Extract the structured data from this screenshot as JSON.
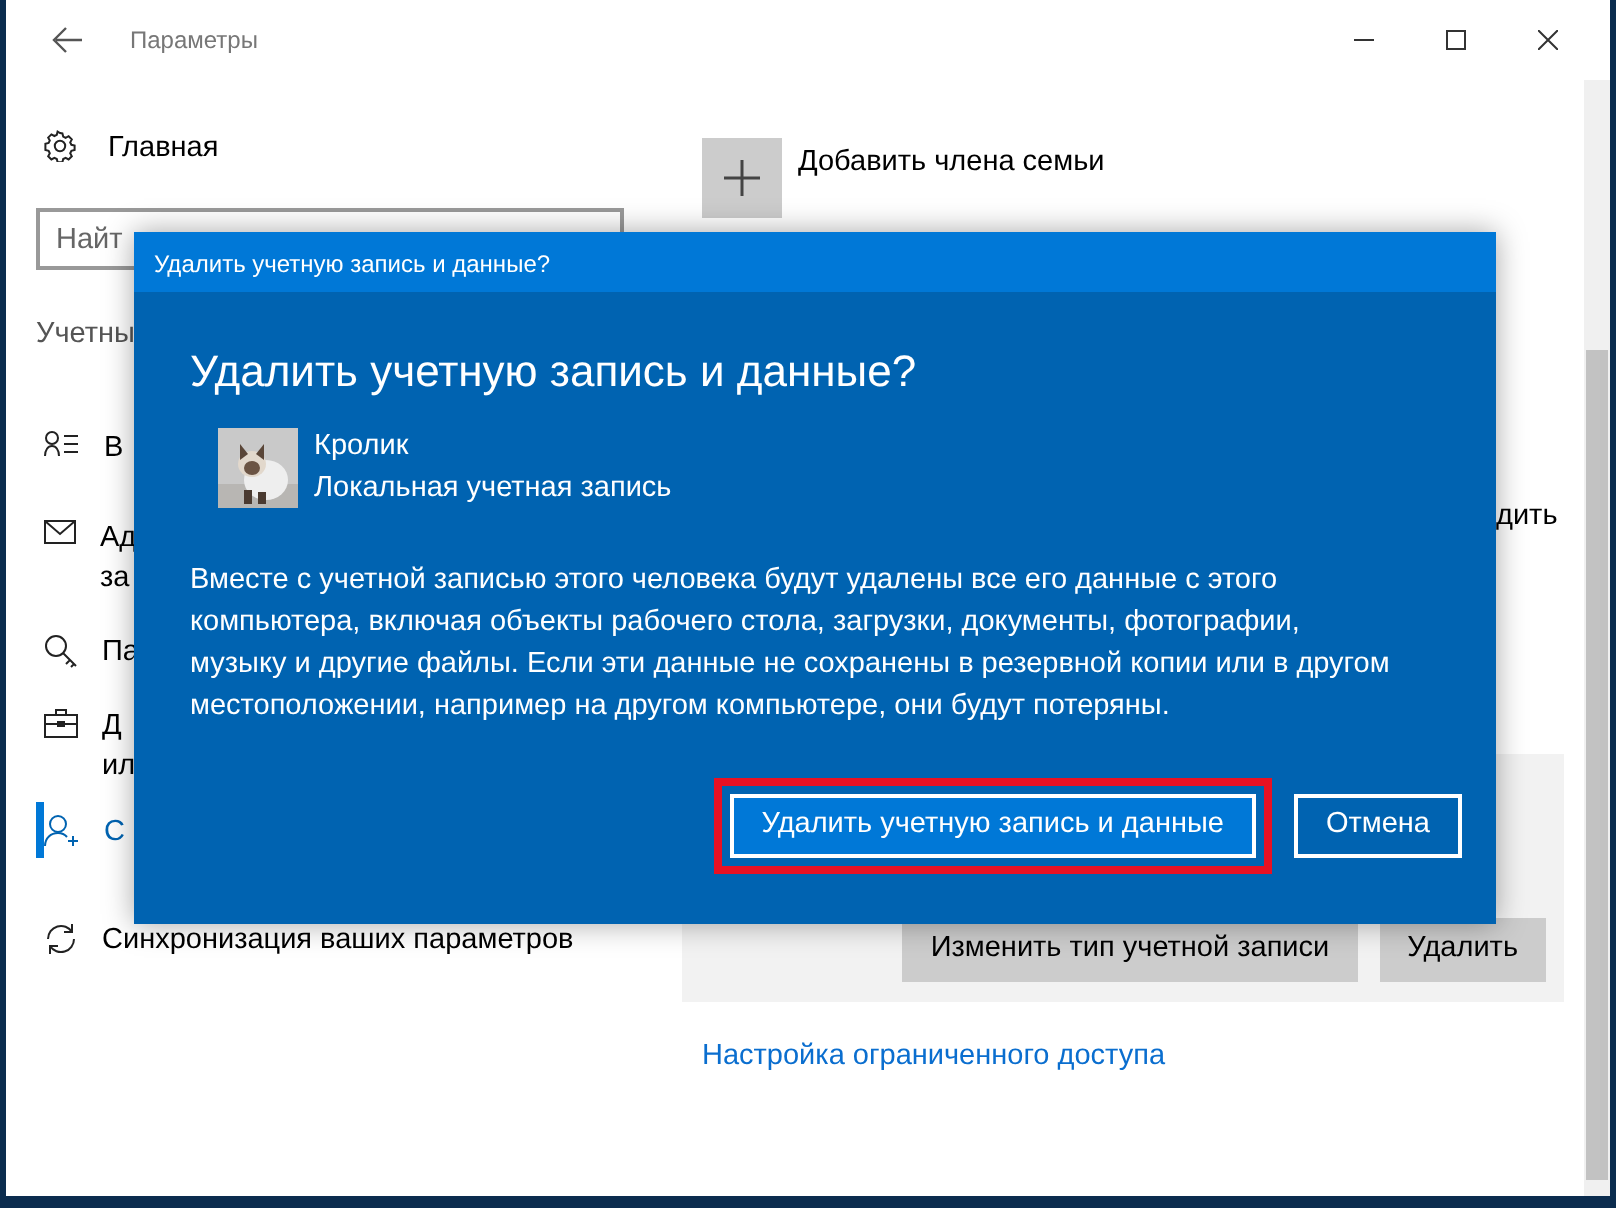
{
  "window": {
    "title": "Параметры"
  },
  "sidebar": {
    "home": "Главная",
    "search": {
      "placeholder": "Найт"
    },
    "section": "Учетны",
    "items": [
      {
        "lines": [
          "В"
        ],
        "selected": false
      },
      {
        "lines": [
          "Ад",
          "за"
        ],
        "selected": false
      },
      {
        "lines": [
          "Па"
        ],
        "selected": false
      },
      {
        "lines": [
          "Д",
          "ил"
        ],
        "selected": false
      },
      {
        "lines": [
          "С"
        ],
        "selected": true
      },
      {
        "lines": [
          "Синхронизация ваших параметров"
        ],
        "selected": false
      }
    ]
  },
  "main": {
    "add_family": "Добавить члена семьи",
    "fragment": "дить",
    "account_buttons": [
      "Изменить тип учетной записи",
      "Удалить"
    ],
    "link": "Настройка ограниченного доступа"
  },
  "dialog": {
    "title": "Удалить учетную запись и данные?",
    "heading": "Удалить учетную запись и данные?",
    "user": {
      "name": "Кролик",
      "type": "Локальная учетная запись"
    },
    "message": "Вместе с учетной записью этого человека будут удалены все его данные с этого компьютера, включая объекты рабочего стола, загрузки, документы, фотографии, музыку и другие файлы. Если эти данные не сохранены в резервной копии или в другом местоположении, например на другом компьютере, они будут потеряны.",
    "buttons": [
      {
        "label": "Удалить учетную запись и данные",
        "primary": true,
        "highlighted": true
      },
      {
        "label": "Отмена",
        "primary": false,
        "highlighted": false
      }
    ]
  }
}
